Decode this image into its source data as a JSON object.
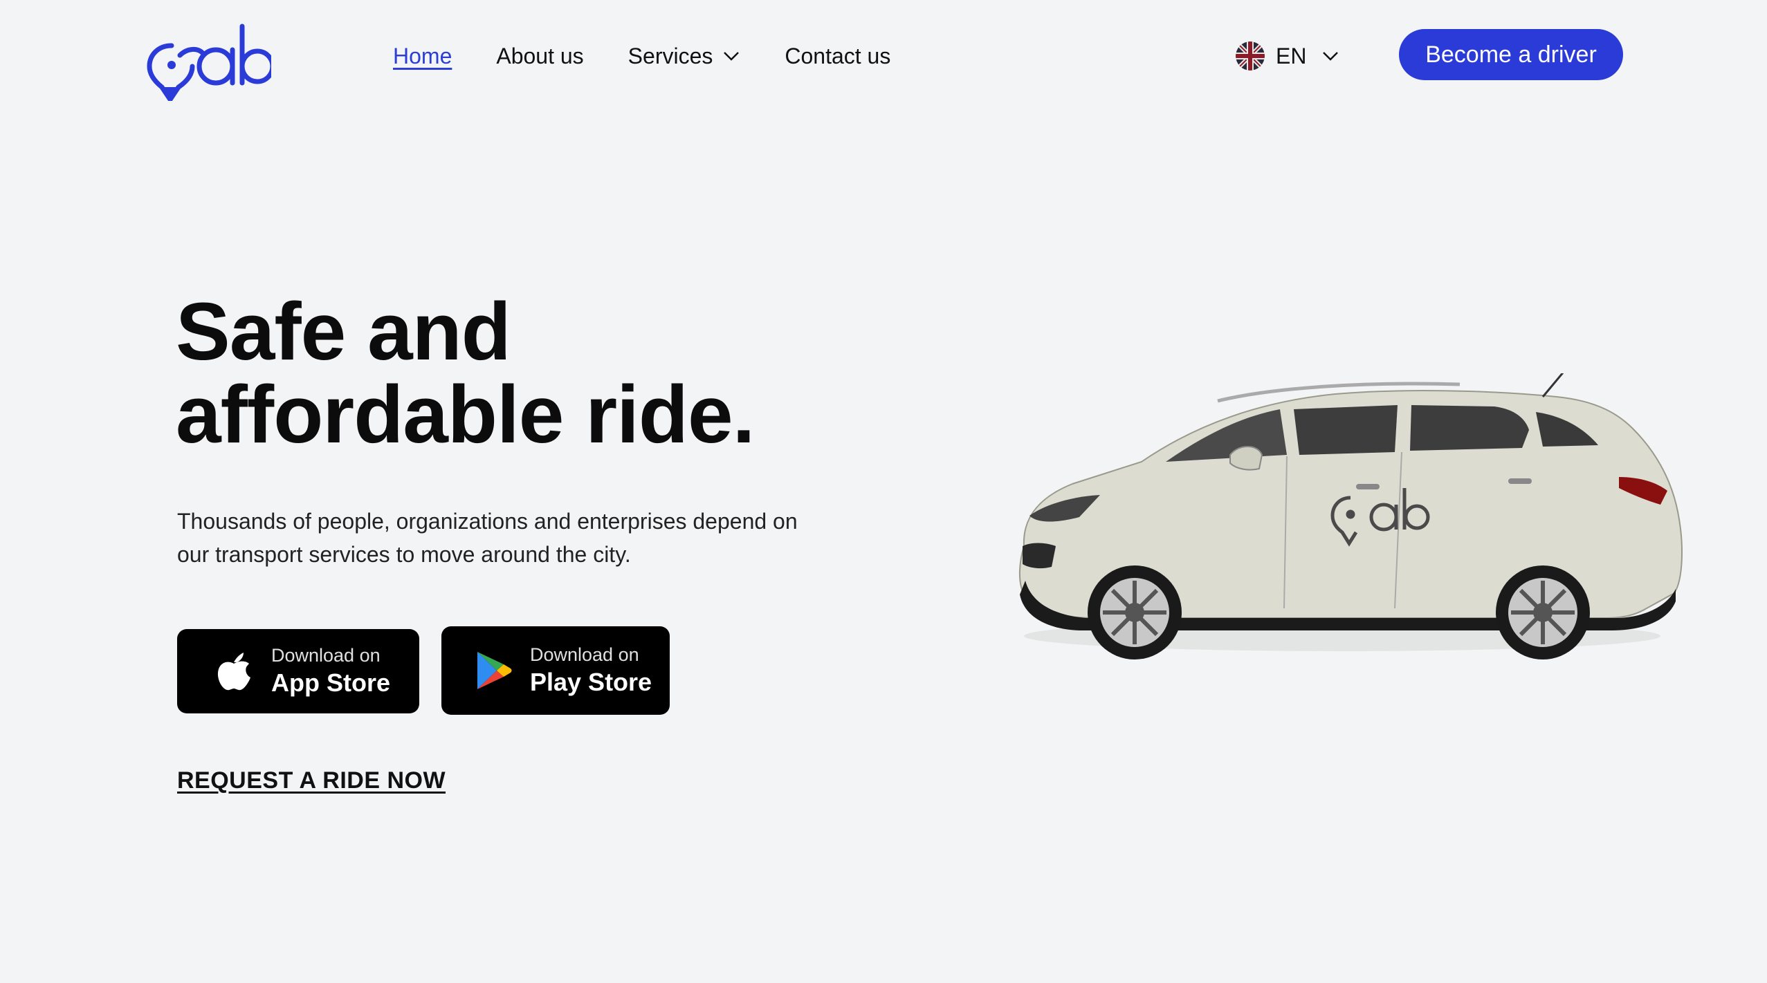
{
  "brand": {
    "logo_text": "gab",
    "logo_color": "#2b3bd8"
  },
  "nav": {
    "items": [
      {
        "label": "Home",
        "active": true
      },
      {
        "label": "About us",
        "active": false
      },
      {
        "label": "Services",
        "active": false,
        "dropdown": true
      },
      {
        "label": "Contact us",
        "active": false
      }
    ]
  },
  "language": {
    "code": "EN",
    "flag_icon": "uk-flag-icon"
  },
  "cta": {
    "label": "Become a driver",
    "color": "#2b3bd8"
  },
  "hero": {
    "title_line1": "Safe and",
    "title_line2": "affordable ride.",
    "description": "Thousands of people, organizations and enterprises depend on our transport services to move around the city."
  },
  "stores": {
    "apple": {
      "small": "Download on",
      "big": "App Store",
      "icon": "apple-icon"
    },
    "play": {
      "small": "Download on",
      "big": "Play Store",
      "icon": "play-store-icon"
    }
  },
  "request_link": "REQUEST A RIDE NOW",
  "car_logo_text": "gab"
}
